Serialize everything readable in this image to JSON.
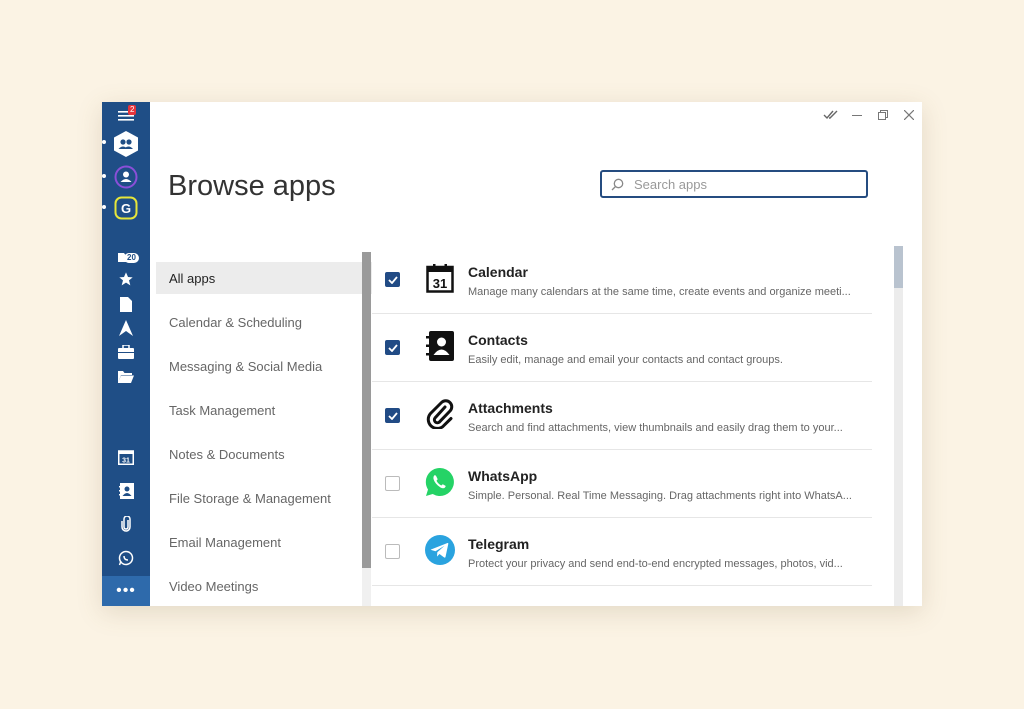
{
  "page": {
    "title": "Browse apps"
  },
  "search": {
    "placeholder": "Search apps",
    "value": ""
  },
  "rail": {
    "menu_badge": "2",
    "inbox_count": "20",
    "calendar_day": "31"
  },
  "categories": [
    {
      "label": "All apps",
      "active": true
    },
    {
      "label": "Calendar & Scheduling"
    },
    {
      "label": "Messaging & Social Media"
    },
    {
      "label": "Task Management"
    },
    {
      "label": "Notes & Documents"
    },
    {
      "label": "File Storage & Management"
    },
    {
      "label": "Email Management"
    },
    {
      "label": "Video Meetings"
    }
  ],
  "apps": [
    {
      "name": "Calendar",
      "description": "Manage many calendars at the same time, create events and organize meeti...",
      "checked": true,
      "icon": "calendar-icon",
      "icon_text": "31"
    },
    {
      "name": "Contacts",
      "description": "Easily edit, manage and email your contacts and contact groups.",
      "checked": true,
      "icon": "contacts-icon"
    },
    {
      "name": "Attachments",
      "description": "Search and find attachments, view thumbnails and easily drag them to your...",
      "checked": true,
      "icon": "paperclip-icon"
    },
    {
      "name": "WhatsApp",
      "description": "Simple. Personal. Real Time Messaging. Drag attachments right into WhatsA...",
      "checked": false,
      "icon": "whatsapp-icon",
      "color": "#25d366"
    },
    {
      "name": "Telegram",
      "description": "Protect your privacy and send end-to-end encrypted messages, photos, vid...",
      "checked": false,
      "icon": "telegram-icon",
      "color": "#2aa3df"
    }
  ],
  "colors": {
    "rail": "#1f4e86",
    "accent": "#214b85"
  }
}
